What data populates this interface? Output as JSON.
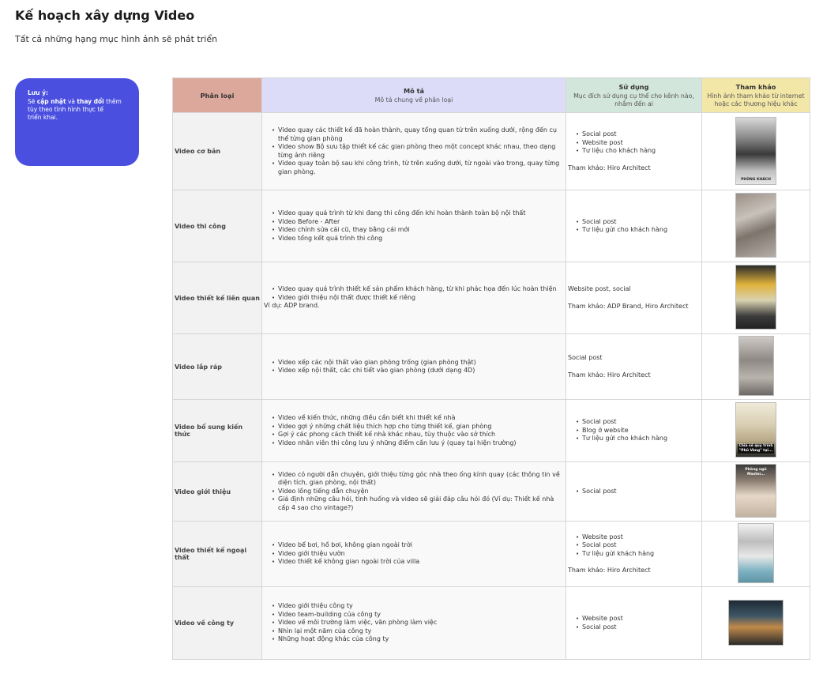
{
  "page": {
    "title": "Kế hoạch xây dựng Video",
    "subtitle": "Tất cả những hạng mục hình ảnh sẽ phát triển"
  },
  "note": {
    "title": "Lưu ý:",
    "line1_pre": "Sẽ ",
    "line1_b1": "cập nhật",
    "line1_mid": " và ",
    "line1_b2": "thay đổi",
    "line1_post": " thêm",
    "line2": "tùy theo tình hình thực tế",
    "line3": "triển khai.",
    "color": "#4a4fe0"
  },
  "table": {
    "headers": {
      "category": "Phân loại",
      "description": "Mô tả",
      "description_sub": "Mô tả chung về phân loại",
      "usage": "Sử dụng",
      "usage_sub": "Mục đích sử dụng cụ thể cho kênh nào, nhắm đến ai",
      "reference": "Tham khảo",
      "reference_sub": "Hình ảnh tham khảo từ internet hoặc các thương hiệu khác"
    },
    "rows": [
      {
        "category": "Video cơ bản",
        "desc": [
          "Video quay các thiết kế đã hoàn thành, quay tổng quan từ trên xuống dưới, rộng đến cụ thể từng gian phòng",
          "Video show Bộ sưu tập thiết kế các gian phòng theo một concept khác nhau, theo dạng từng ảnh riêng",
          "Video quay toàn bộ sau khi công trình, từ trên xuống dưới, từ ngoài vào trong, quay từng gian phòng."
        ],
        "use": [
          "Social post",
          "Website post",
          "Tư liệu cho khách hàng"
        ],
        "use_note": "Tham khảo: Hiro Architect",
        "thumb_caption": "PHÒNG KHÁCH"
      },
      {
        "category": "Video thi công",
        "desc": [
          "Video quay quá trình từ khi đang thi công đến khi hoàn thành toàn bộ nội thất",
          "Video Before - After",
          "Video chỉnh sửa cái cũ, thay bằng cái mới",
          "Video tổng kết quá trình thi công"
        ],
        "use": [
          "Social post",
          "Tư liệu gửi cho khách hàng"
        ]
      },
      {
        "category": "Video thiết kế liên quan",
        "desc": [
          "Video quay quá trình thiết kế sản phẩm khách hàng, từ khi phác họa đến lúc hoàn thiện",
          "Video giới thiệu nội thất được thiết kế riêng"
        ],
        "desc_note": "Ví dụ: ADP brand.",
        "use_text": "Website post, social",
        "use_note": "Tham khảo: ADP Brand, Hiro Architect"
      },
      {
        "category": "Video lắp ráp",
        "desc": [
          "Video xếp các nội thất vào gian phòng trống (gian phòng thật)",
          "Video xếp nội thất, các chi tiết vào gian phòng (dưới dạng 4D)"
        ],
        "use_text": "Social post",
        "use_note": "Tham khảo: Hiro Architect"
      },
      {
        "category": "Video bổ sung kiến thức",
        "desc": [
          "Video về kiến thức, những điều cần biết khi thiết kế nhà",
          "Video gợi ý những chất liệu thích hợp cho từng thiết kế, gian phòng",
          "Gợi ý các phong cách thiết kế nhà khác nhau, tùy thuộc vào sở thích",
          "Video nhân viên thi công lưu ý những điểm cần lưu ý (quay tại hiện trường)"
        ],
        "use": [
          "Social post",
          "Blog ở website",
          "Tư liệu gửi cho khách hàng"
        ],
        "thumb_caption": "Chia sẻ quy trình \"Phủ Vàng\" tại..."
      },
      {
        "category": "Video giới thiệu",
        "desc": [
          "Video có người dẫn chuyện, giới thiệu từng góc nhà theo ống kính quay (các thông tin về diện tích, gian phòng, nội thất)",
          "Video lồng tiếng dẫn chuyện",
          "Giả định những câu hỏi, tình huống và video sẽ giải đáp câu hỏi đó (Ví dụ: Thiết kế nhà cấp 4 sao cho vintage?)"
        ],
        "use": [
          "Social post"
        ],
        "thumb_caption": "Phòng ngủ Master..."
      },
      {
        "category": "Video thiết kế ngoại thất",
        "desc": [
          "Video bể bơi, hồ bơi, không gian ngoài trời",
          "Video giới thiệu vườn",
          "Video thiết kế không gian ngoài trời của villa"
        ],
        "use": [
          "Website post",
          "Social post",
          "Tư liệu gửi khách hàng"
        ],
        "use_note": "Tham khảo: Hiro Architect"
      },
      {
        "category": "Video về công ty",
        "desc": [
          "Video giới thiệu công ty",
          "Video team-building của công ty",
          "Video về môi trường làm việc, văn phòng làm việc",
          "Nhìn lại một năm của công ty",
          "Những hoạt động khác của công ty"
        ],
        "use": [
          "Website post",
          "Social post"
        ]
      }
    ]
  }
}
